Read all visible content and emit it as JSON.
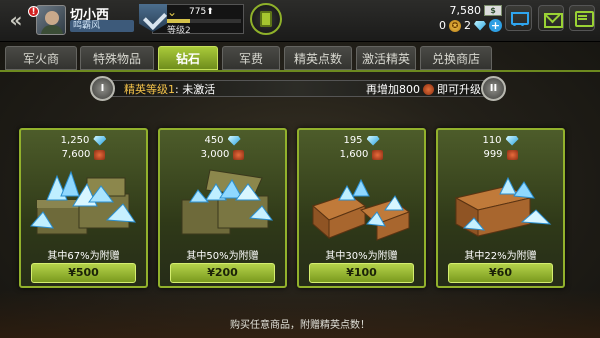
{
  "header": {
    "back_label": "«",
    "alert_badge": "!",
    "player_name": "切小西",
    "player_sub": "鸣霸风",
    "xp_value": "775",
    "xp_progress": 0.33,
    "level_text": "等级2",
    "gold_value": "7,580",
    "gold_icon": "cash-icon",
    "medal_count": "0",
    "gem_count": "2",
    "icons": [
      "back-icon",
      "avatar",
      "rank-emblem-icon",
      "dogtag-icon",
      "cart-icon",
      "mail-icon",
      "chat-icon"
    ]
  },
  "tabs": [
    {
      "label": "军火商",
      "active": false
    },
    {
      "label": "特殊物品",
      "active": false
    },
    {
      "label": "钻石",
      "active": true
    },
    {
      "label": "军费",
      "active": false
    },
    {
      "label": "精英点数",
      "active": false
    },
    {
      "label": "激活精英",
      "active": false
    },
    {
      "label": "兑换商店",
      "active": false
    }
  ],
  "elite": {
    "left_badge": "I",
    "status_label": "精英等级1",
    "status_value": ": 未激活",
    "upgrade_prefix": "再增加800",
    "upgrade_suffix": "即可升级",
    "right_badge": "II"
  },
  "offers": [
    {
      "gems": "1,250",
      "bonus_points": "7,600",
      "bonus_text": "其中67%为附赠",
      "price": "¥500",
      "crate": "metal"
    },
    {
      "gems": "450",
      "bonus_points": "3,000",
      "bonus_text": "其中50%为附赠",
      "price": "¥200",
      "crate": "metal"
    },
    {
      "gems": "195",
      "bonus_points": "1,600",
      "bonus_text": "其中30%为附赠",
      "price": "¥100",
      "crate": "wood"
    },
    {
      "gems": "110",
      "bonus_points": "999",
      "bonus_text": "其中22%为附赠",
      "price": "¥60",
      "crate": "wood"
    }
  ],
  "footer": "购买任意商品，附赠精英点数！",
  "colors": {
    "accent_green": "#92b12c",
    "gem_blue": "#2ca9e6",
    "gold": "#f4c34a"
  }
}
